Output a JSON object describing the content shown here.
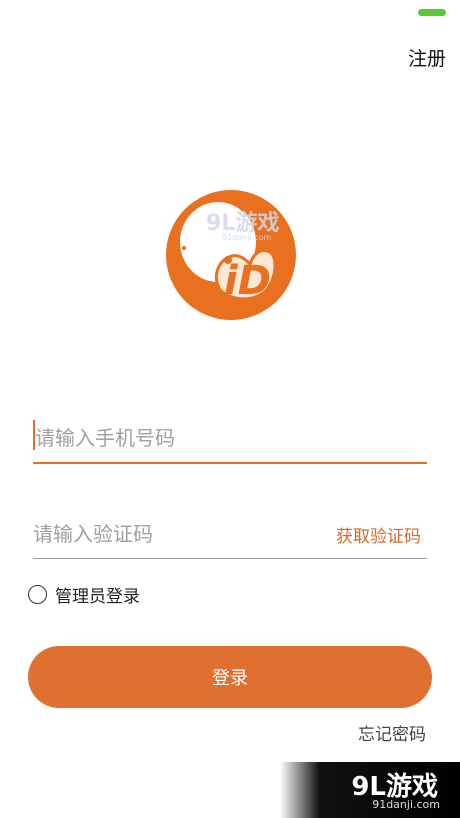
{
  "header": {
    "register_label": "注册"
  },
  "logo": {
    "letters": "iD"
  },
  "phone": {
    "placeholder": "请输入手机号码",
    "value": ""
  },
  "code": {
    "placeholder": "请输入验证码",
    "value": "",
    "get_code_label": "获取验证码"
  },
  "admin": {
    "label": "管理员登录",
    "checked": false
  },
  "login": {
    "label": "登录"
  },
  "forgot": {
    "label": "忘记密码"
  },
  "watermark": {
    "brand": "9L游戏",
    "site": "91danji.com"
  },
  "colors": {
    "accent": "#e07030",
    "status": "#5ac832"
  }
}
